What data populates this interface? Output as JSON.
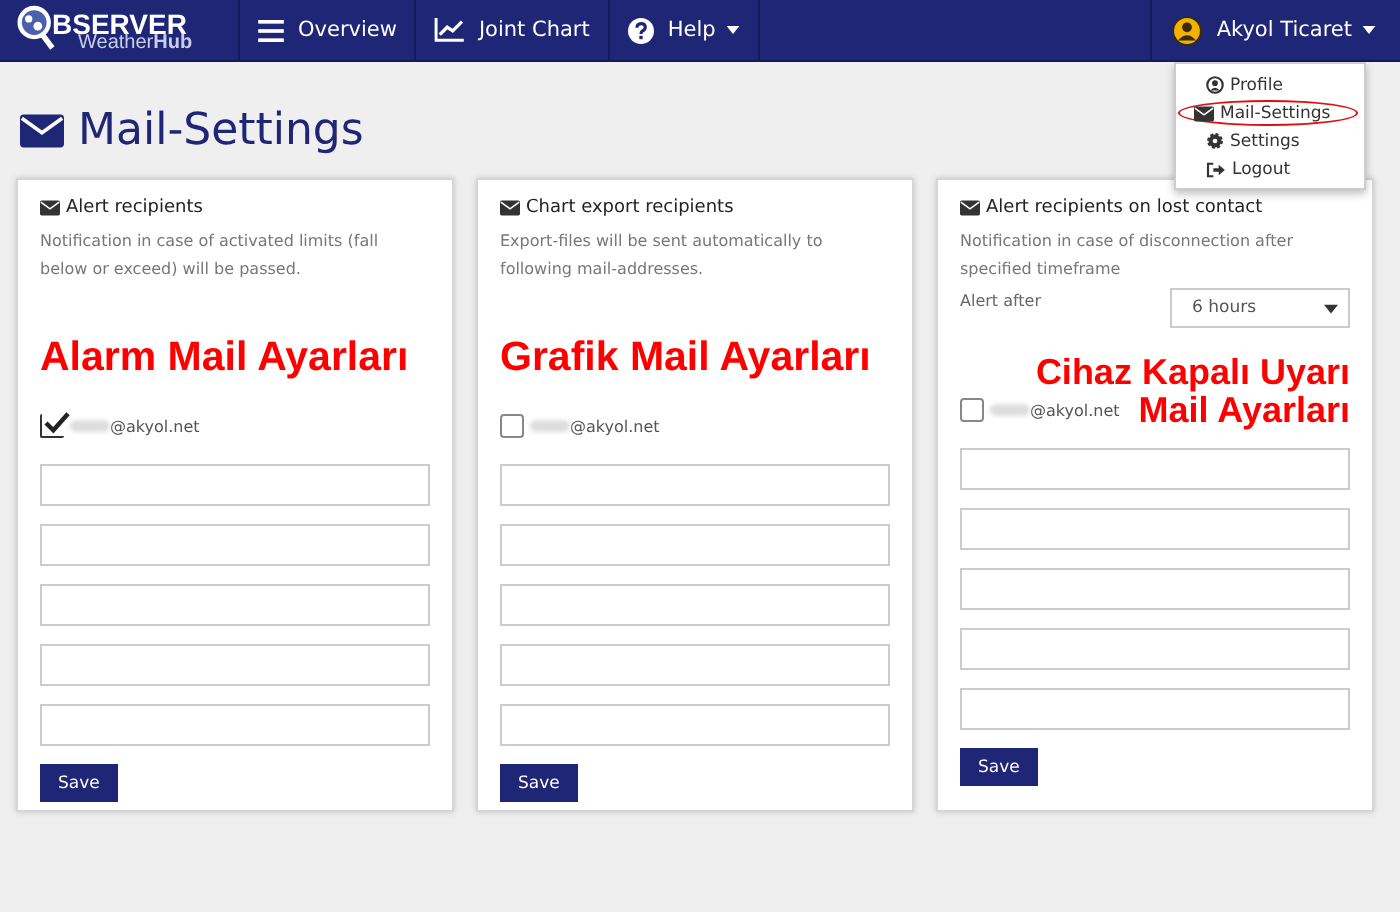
{
  "navbar": {
    "logo": {
      "title": "BSERVER",
      "subtitle": "Weather**Hub**"
    },
    "items": [
      {
        "kind": "menu",
        "label": "Overview",
        "dropdown": false
      },
      {
        "kind": "chart",
        "label": "Joint Chart",
        "dropdown": false
      },
      {
        "kind": "help",
        "label": "Help",
        "dropdown": true
      }
    ],
    "user": {
      "label": "Akyol Ticaret",
      "expanded": true,
      "menu": [
        {
          "kind": "profile",
          "label": "Profile",
          "circled": false
        },
        {
          "kind": "mail",
          "label": "Mail-Settings",
          "circled": true
        },
        {
          "kind": "settings",
          "label": "Settings",
          "circled": false
        },
        {
          "kind": "logout",
          "label": "Logout",
          "circled": false
        }
      ]
    }
  },
  "page_title": "Mail-Settings",
  "cards": [
    {
      "title": "Alert recipients",
      "description": "Notification in case of activated limits (fall below or exceed) will be passed.",
      "annotation": [
        "Alarm Mail Ayarları"
      ],
      "recipient": {
        "email": "@akyol.net",
        "checked": true
      },
      "fields": [
        {
          "kind": "email"
        },
        {
          "kind": "email"
        },
        {
          "kind": "email"
        },
        {
          "kind": "email"
        },
        {
          "kind": "email"
        }
      ],
      "button": "Save"
    },
    {
      "title": "Chart export recipients",
      "description": "Export-files will be sent automatically to following mail-addresses.",
      "annotation": [
        "Grafik Mail Ayarları"
      ],
      "recipient": {
        "email": "@akyol.net",
        "checked": false
      },
      "fields": [
        {
          "kind": "email"
        },
        {
          "kind": "email"
        },
        {
          "kind": "email"
        },
        {
          "kind": "email"
        },
        {
          "kind": "email"
        }
      ],
      "button": "Save"
    },
    {
      "title": "Alert recipients on lost contact",
      "description": "Notification in case of disconnection after specified timeframe",
      "alert_after": {
        "label": "Alert after",
        "value": "6 hours"
      },
      "annotation": [
        "Cihaz Kapalı Uyarı",
        "Mail Ayarları"
      ],
      "recipient": {
        "email": "@akyol.net",
        "checked": false
      },
      "fields": [
        {
          "kind": "email"
        },
        {
          "kind": "email"
        },
        {
          "kind": "email"
        },
        {
          "kind": "email"
        },
        {
          "kind": "email"
        }
      ],
      "button": "Save"
    }
  ]
}
